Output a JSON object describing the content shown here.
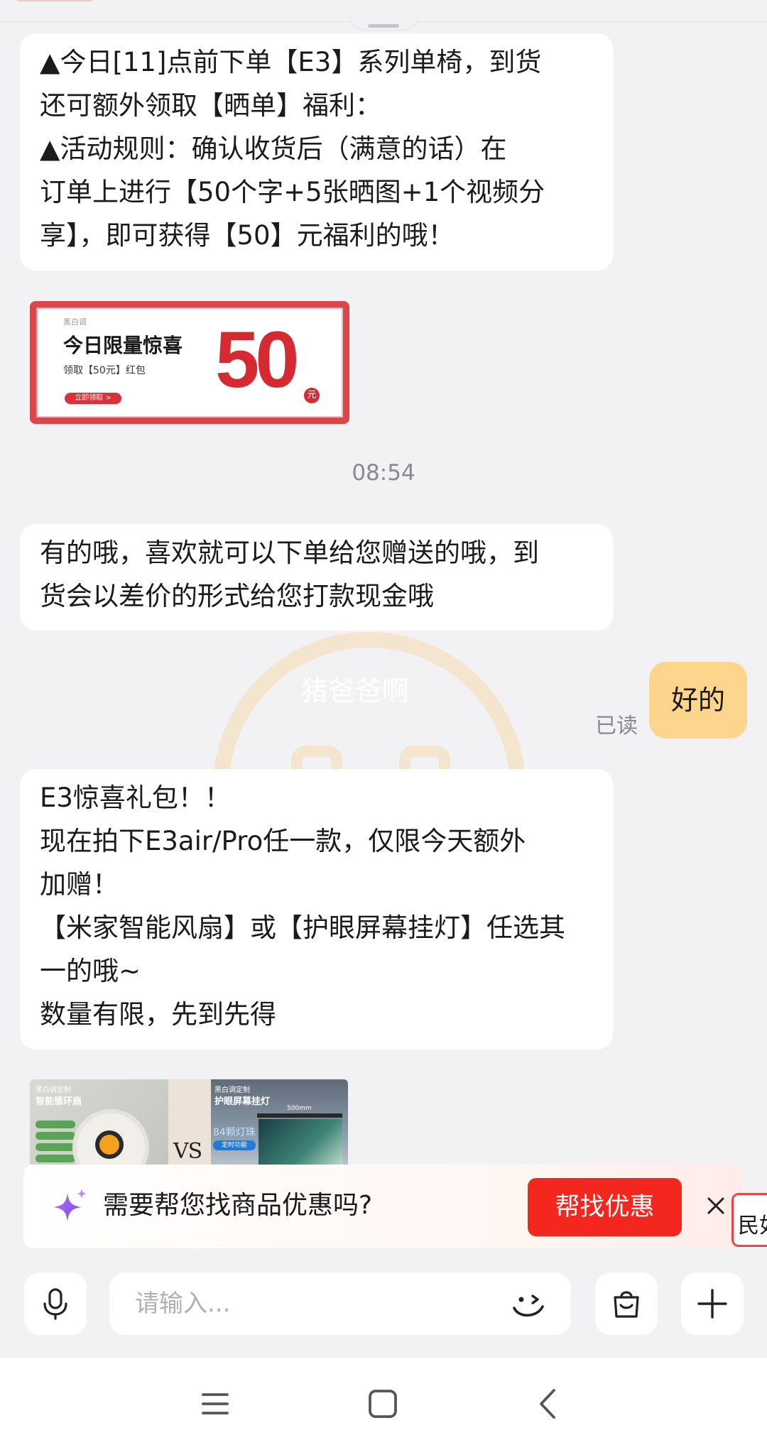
{
  "messages": {
    "m1": {
      "lines": [
        "▲今日[11]点前下单【E3】系列单椅，到货",
        "还可额外领取【晒单】福利：",
        "▲活动规则：确认收货后（满意的话）在",
        "订单上进行【50个字+5张晒图+1个视频分",
        "享】，即可获得【50】元福利的哦！"
      ]
    },
    "coupon": {
      "brand": "黑白调",
      "title": "今日限量惊喜",
      "desc": "领取【50元】红包",
      "cta": "立即领取 >",
      "amount": "50",
      "unit": "元"
    },
    "timestamp": "08:54",
    "m2": {
      "lines": [
        "有的哦，喜欢就可以下单给您赠送的哦，到",
        "货会以差价的形式给您打款现金哦"
      ]
    },
    "watermark_text": "猪爸爸啊",
    "sent": {
      "text": "好的",
      "status": "已读"
    },
    "m3": {
      "lines": [
        "E3惊喜礼包！！",
        "现在拍下E3air/Pro任一款，仅限今天额外",
        "加赠！",
        "【米家智能风扇】或【护眼屏幕挂灯】任选其",
        "一的哦~",
        "数量有限，先到先得"
      ]
    },
    "product_card": {
      "left_brand": "黑白调定制",
      "left_title": "智能循环扇",
      "vs": "VS",
      "right_brand": "黑白调定制",
      "right_title": "护眼屏幕挂灯",
      "right_size": "500mm",
      "right_feature": "84颗灯珠",
      "right_badge": "定时功能"
    }
  },
  "promo": {
    "text": "需要帮您找商品优惠吗?",
    "button": "帮找优惠",
    "side_tab": "民如"
  },
  "input": {
    "placeholder": "请输入..."
  },
  "colors": {
    "accent_red": "#f4271f",
    "sent_bubble": "#fdd58c",
    "background": "#f2f2f5"
  },
  "icons": {
    "mic": "microphone-icon",
    "emoji": "emoji-icon",
    "bag": "shopping-bag-icon",
    "plus": "plus-icon",
    "sparkle": "sparkle-icon",
    "close": "close-icon",
    "nav_menu": "menu-icon",
    "nav_home": "home-icon",
    "nav_back": "back-icon"
  }
}
